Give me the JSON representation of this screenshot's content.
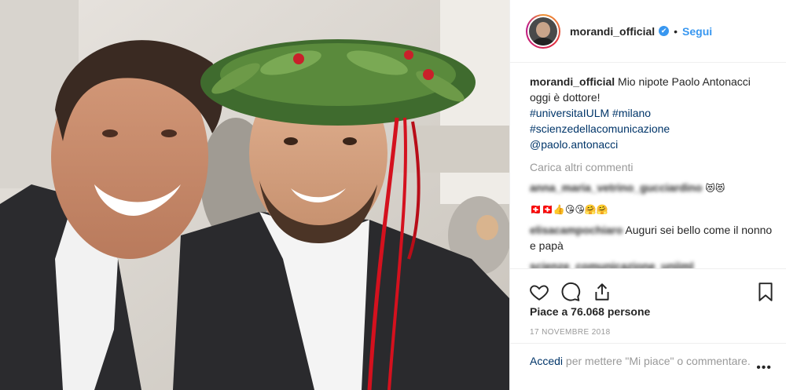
{
  "post": {
    "username": "morandi_official",
    "verified_glyph": "✔",
    "separator": "•",
    "follow_label": "Segui",
    "caption_text": "Mio nipote Paolo Antonacci oggi è dottore!",
    "hashtags": [
      "#universitaIULM",
      "#milano",
      "#scienzedellacomunicazione"
    ],
    "mention": "@paolo.antonacci",
    "load_more": "Carica altri commenti",
    "comments": [
      {
        "username": "anna_maria_vetrino_gucciardino",
        "text": "😻😻"
      },
      {
        "username": "",
        "text": "🇨🇭🇨🇭👍😘😘🤗🤗"
      },
      {
        "username": "elisacampochiaro",
        "text": "Auguri sei bello come il nonno e papà"
      },
      {
        "username": "scienze_comunicazione_uniiml",
        "text": ""
      }
    ],
    "likes": "Piace a 76.068 persone",
    "date": "17 NOVEMBRE 2018",
    "login_link": "Accedi",
    "login_text": "per mettere \"Mi piace\" o commentare.",
    "more_options": "•••"
  },
  "icons": {
    "like": "heart-icon",
    "comment": "comment-icon",
    "share": "share-icon",
    "save": "bookmark-icon"
  },
  "colors": {
    "link_blue": "#3897f0",
    "hashtag_blue": "#003569",
    "muted": "#999999",
    "ribbon_red": "#d4111e"
  }
}
